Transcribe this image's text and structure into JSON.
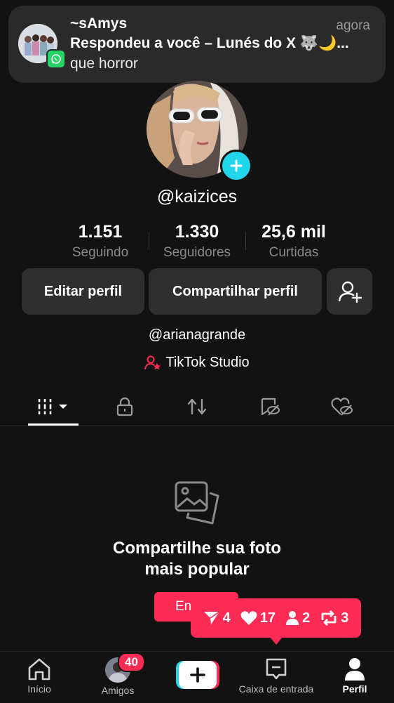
{
  "notification": {
    "sender": "~sAmys",
    "time": "agora",
    "title": "Respondeu a você – Lunés do X 🐺🌙...",
    "body": "que horror",
    "app_icon": "whatsapp-icon"
  },
  "profile": {
    "username": "@kaizices",
    "stats": [
      {
        "value": "1.151",
        "label": "Seguindo"
      },
      {
        "value": "1.330",
        "label": "Seguidores"
      },
      {
        "value": "25,6 mil",
        "label": "Curtidas"
      }
    ],
    "buttons": {
      "edit": "Editar perfil",
      "share": "Compartilhar perfil",
      "add_friend_icon": "add-user-icon"
    },
    "bio_link": "@arianagrande",
    "studio": "TikTok Studio"
  },
  "tabs": [
    "videos-grid-icon",
    "lock-icon",
    "repost-icon",
    "bookmark-hidden-icon",
    "liked-hidden-icon"
  ],
  "empty_state": {
    "line1": "Compartilhe sua foto",
    "line2": "mais popular"
  },
  "enter_button": "En",
  "activity": {
    "messages": "4",
    "likes": "17",
    "followers": "2",
    "reposts": "3"
  },
  "bottom_nav": {
    "home": "Início",
    "friends": "Amigos",
    "friends_badge": "40",
    "inbox": "Caixa de entrada",
    "profile": "Perfil"
  },
  "colors": {
    "accent": "#fe2c55",
    "cyan": "#20d5ec",
    "background": "#121212"
  }
}
